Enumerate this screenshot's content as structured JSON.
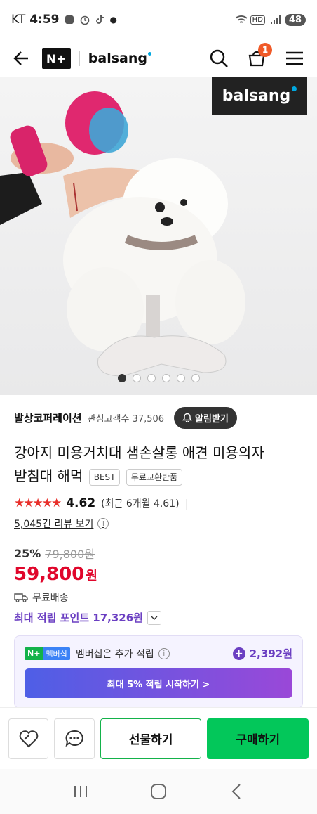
{
  "status_bar": {
    "carrier": "KT",
    "time": "4:59",
    "battery": "48"
  },
  "header": {
    "nplus_logo": "N+",
    "brand": "balsang",
    "cart_count": "1",
    "icons": [
      "back-arrow-icon",
      "search-icon",
      "cart-icon",
      "menu-icon"
    ]
  },
  "hero": {
    "badge_brand": "balsang",
    "slide_count": 6,
    "active_slide": 1
  },
  "seller": {
    "name": "발상코퍼레이션",
    "followers": "관심고객수 37,506",
    "alarm_label": "알림받기"
  },
  "product": {
    "title_line1": "강아지 미용거치대 샘손살롱 애견 미용의자",
    "title_line2": "받침대 해먹",
    "tag_best": "BEST",
    "tag_return": "무료교환반품",
    "stars": "★★★★★",
    "rating": "4.62",
    "rating_recent": "(최근 6개월 4.61)",
    "reviews": "5,045건 리뷰 보기",
    "discount": "25%",
    "original_price": "79,800원",
    "price": "59,800",
    "price_unit": "원",
    "shipping": "무료배송",
    "max_points": "최대 적립 포인트 17,326원"
  },
  "membership": {
    "badge_np": "N+",
    "badge_ms": "멤버십",
    "text": "멤버십은 추가 적립",
    "points": "2,392원",
    "start_label": "최대 5% 적립 시작하기 >"
  },
  "actions": {
    "gift_label": "선물하기",
    "buy_label": "구매하기"
  },
  "colors": {
    "price_red": "#e0062b",
    "naver_green": "#03c75a",
    "points_purple": "#6b3fc2"
  }
}
